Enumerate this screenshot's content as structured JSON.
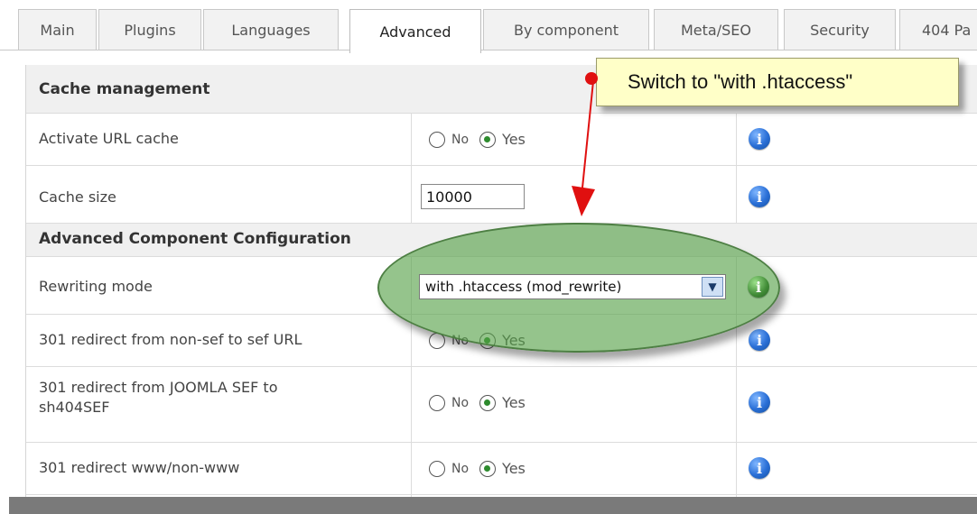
{
  "tabs": [
    "Main",
    "Plugins",
    "Languages",
    "Advanced",
    "By component",
    "Meta/SEO",
    "Security",
    "404 Pa"
  ],
  "active_tab": "Advanced",
  "sections": {
    "cache_header": "Cache management",
    "advanced_header": "Advanced Component Configuration"
  },
  "rows": {
    "activate_url_cache": "Activate URL cache",
    "cache_size": "Cache size",
    "rewriting_mode": "Rewriting mode",
    "redirect_nonsef": "301 redirect from non-sef to sef URL",
    "redirect_joomla_line1": "301 redirect from JOOMLA SEF to",
    "redirect_joomla_line2": "sh404SEF",
    "redirect_www": "301 redirect www/non-www"
  },
  "options": {
    "no": "No",
    "yes": "Yes"
  },
  "inputs": {
    "cache_size_value": "10000",
    "rewriting_mode_value": "with .htaccess (mod_rewrite)"
  },
  "annotation": {
    "callout_text": "Switch to \"with .htaccess\""
  },
  "icons": {
    "info": "info-icon",
    "radio_selected_color": "#2e8b2e"
  },
  "colors": {
    "header_bg": "#f0f0f0",
    "highlight": "#54a046",
    "callout_bg": "#ffffc8",
    "arrow": "#e01010"
  }
}
